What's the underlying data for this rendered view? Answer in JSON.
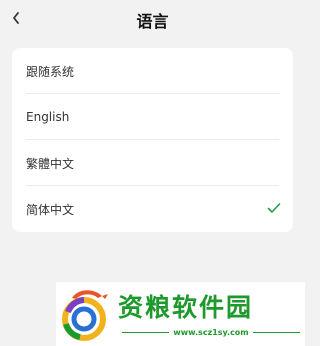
{
  "header": {
    "title": "语言",
    "back_icon": "chevron-left-icon"
  },
  "languages": [
    {
      "label": "跟随系统",
      "selected": false
    },
    {
      "label": "English",
      "selected": false
    },
    {
      "label": "繁體中文",
      "selected": false
    },
    {
      "label": "简体中文",
      "selected": true
    }
  ],
  "check_icon": "checkmark-icon",
  "watermark": {
    "name": "资粮软件园",
    "url": "www.scz1sy.com"
  },
  "colors": {
    "background": "#f2f2f2",
    "card": "#ffffff",
    "check": "#2e9b4f",
    "watermark": "#1e9a2c"
  }
}
